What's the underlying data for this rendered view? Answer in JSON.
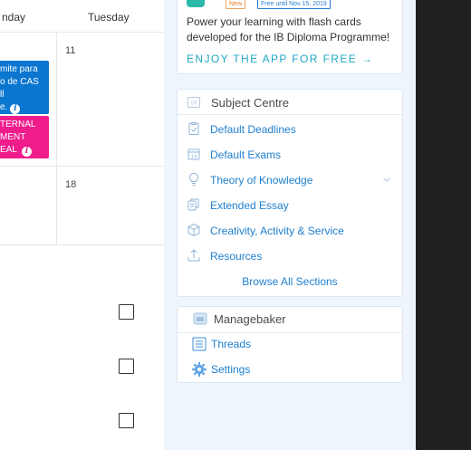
{
  "calendar": {
    "day_headers": [
      "nday",
      "Tuesday"
    ],
    "day_numbers": [
      "11",
      "18"
    ],
    "events": [
      {
        "lines": [
          "mite para",
          "o de CAS",
          "ll",
          "e."
        ],
        "color": "#0b76d0"
      },
      {
        "lines": [
          "TERNAL",
          "MENT",
          "EAL"
        ],
        "color": "#ef1c8c"
      }
    ]
  },
  "promo": {
    "badge_new": "New",
    "badge_free": "Free until Nov 15, 2019",
    "text": "Power your learning with flash cards developed for the IB Diploma Programme!",
    "cta": "ENJOY THE APP FOR FREE →"
  },
  "subject_centre": {
    "title": "Subject Centre",
    "items": [
      {
        "label": "Default Deadlines",
        "icon": "clipboard-check-icon"
      },
      {
        "label": "Default Exams",
        "icon": "calendar-14-icon"
      },
      {
        "label": "Theory of Knowledge",
        "icon": "lightbulb-icon"
      },
      {
        "label": "Extended Essay",
        "icon": "documents-icon"
      },
      {
        "label": "Creativity, Activity & Service",
        "icon": "cube-icon"
      },
      {
        "label": "Resources",
        "icon": "upload-icon"
      }
    ],
    "browse": "Browse All Sections"
  },
  "managebaker": {
    "title": "Managebaker",
    "items": [
      {
        "label": "Threads",
        "icon": "threads-icon"
      },
      {
        "label": "Settings",
        "icon": "gear-icon"
      }
    ]
  },
  "colors": {
    "accent": "#1e7fcf",
    "event_blue": "#0b76d0",
    "event_pink": "#ef1c8c",
    "cta": "#1fa8c4"
  }
}
